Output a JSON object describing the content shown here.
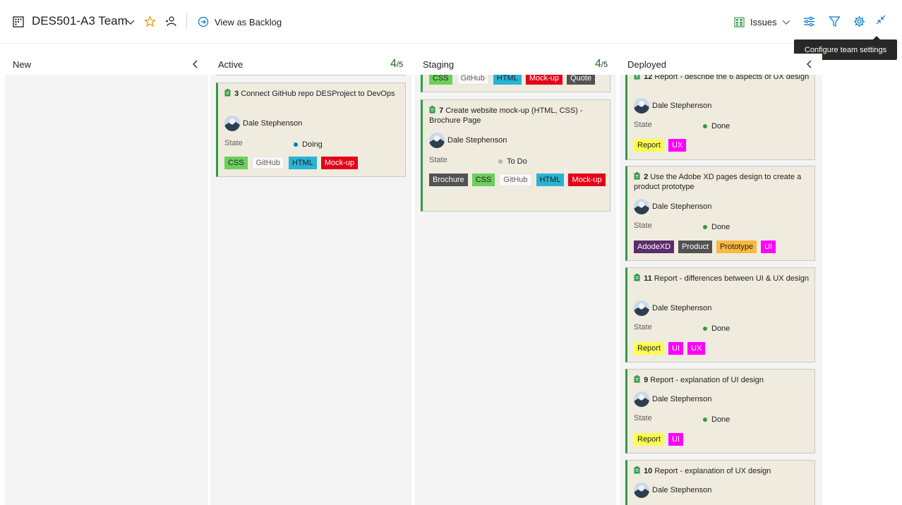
{
  "header": {
    "team_name": "DES501-A3 Team",
    "view_backlog_label": "View as Backlog",
    "issues_label": "Issues"
  },
  "tooltip": {
    "text": "Configure team settings"
  },
  "columns": {
    "new": {
      "title": "New"
    },
    "active": {
      "title": "Active",
      "count": "4",
      "limit": "/5"
    },
    "staging": {
      "title": "Staging",
      "count": "4",
      "limit": "/5"
    },
    "deployed": {
      "title": "Deployed"
    }
  },
  "tag_colors": {
    "CSS": {
      "bg": "#6ccf5b",
      "fg": "#201f1e"
    },
    "GitHub": {
      "bg": "#f8f8f8",
      "fg": "#605e5c"
    },
    "HTML": {
      "bg": "#2ab3d5",
      "fg": "#201f1e"
    },
    "Mock-up": {
      "bg": "#e60017",
      "fg": "#ffffff"
    },
    "Quote": {
      "bg": "#525252",
      "fg": "#ffffff"
    },
    "Brochure": {
      "bg": "#525252",
      "fg": "#ffffff"
    },
    "Report": {
      "bg": "#fbfd52",
      "fg": "#201f1e"
    },
    "UX": {
      "bg": "#ff00ff",
      "fg": "#ffffff"
    },
    "UI": {
      "bg": "#ff00ff",
      "fg": "#ffffff"
    },
    "AdodeXD": {
      "bg": "#5c2d6c",
      "fg": "#ffffff"
    },
    "Product": {
      "bg": "#525252",
      "fg": "#ffffff"
    },
    "Prototype": {
      "bg": "#f7b942",
      "fg": "#201f1e"
    }
  },
  "state_colors": {
    "Doing": "#007acc",
    "To Do": "#b2b2b2",
    "Done": "#339947"
  },
  "cards": {
    "active_3": {
      "id": "3",
      "title": "Connect GitHub repo DESProject to DevOps",
      "assignee": "Dale Stephenson",
      "state_label": "State",
      "state": "Doing",
      "tags": [
        "CSS",
        "GitHub",
        "HTML",
        "Mock-up"
      ]
    },
    "staging_partial": {
      "tags": [
        "CSS",
        "GitHub",
        "HTML",
        "Mock-up",
        "Quote"
      ]
    },
    "staging_7": {
      "id": "7",
      "title": "Create website mock-up (HTML, CSS) - Brochure Page",
      "assignee": "Dale Stephenson",
      "state_label": "State",
      "state": "To Do",
      "tags": [
        "Brochure",
        "CSS",
        "GitHub",
        "HTML",
        "Mock-up"
      ]
    },
    "deployed_12": {
      "id": "12",
      "title": "Report - describe the 6 aspects of UX design",
      "assignee": "Dale Stephenson",
      "state_label": "State",
      "state": "Done",
      "tags": [
        "Report",
        "UX"
      ]
    },
    "deployed_2": {
      "id": "2",
      "title": "Use the Adobe XD pages design to create a product prototype",
      "assignee": "Dale Stephenson",
      "state_label": "State",
      "state": "Done",
      "tags": [
        "AdodeXD",
        "Product",
        "Prototype",
        "UI"
      ]
    },
    "deployed_11": {
      "id": "11",
      "title": "Report - differences between UI & UX design",
      "assignee": "Dale Stephenson",
      "state_label": "State",
      "state": "Done",
      "tags": [
        "Report",
        "UI",
        "UX"
      ]
    },
    "deployed_9": {
      "id": "9",
      "title": "Report - explanation of UI design",
      "assignee": "Dale Stephenson",
      "state_label": "State",
      "state": "Done",
      "tags": [
        "Report",
        "UI"
      ]
    },
    "deployed_10": {
      "id": "10",
      "title": "Report - explanation of UX design",
      "assignee": "Dale Stephenson"
    }
  }
}
